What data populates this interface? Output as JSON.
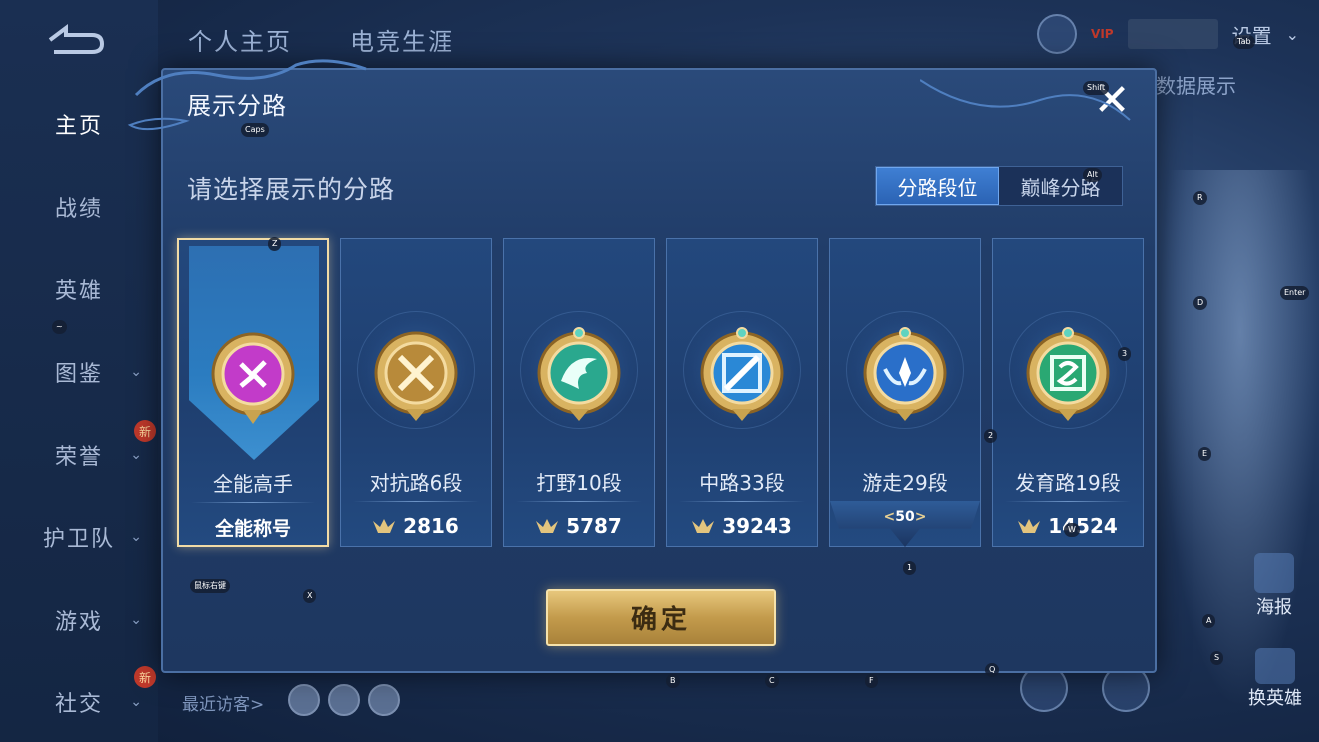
{
  "background": {
    "top_tabs": [
      "个人主页",
      "电竞生涯"
    ],
    "sidebar": [
      {
        "label": "主页",
        "active": true,
        "chevron": false,
        "badge": ""
      },
      {
        "label": "战绩",
        "active": false,
        "chevron": false,
        "badge": ""
      },
      {
        "label": "英雄",
        "active": false,
        "chevron": false,
        "badge": ""
      },
      {
        "label": "图鉴",
        "active": false,
        "chevron": true,
        "badge": ""
      },
      {
        "label": "荣誉",
        "active": false,
        "chevron": true,
        "badge": "新"
      },
      {
        "label": "护卫队",
        "active": false,
        "chevron": true,
        "badge": ""
      },
      {
        "label": "游戏",
        "active": false,
        "chevron": true,
        "badge": ""
      },
      {
        "label": "社交",
        "active": false,
        "chevron": true,
        "badge": "新"
      }
    ],
    "settings_label": "设置",
    "vip_label": "VIP",
    "right_text": "数据展示",
    "right_button_1": "海报",
    "right_button_2": "换英雄",
    "visitor_label": "最近访客>"
  },
  "key_hints": {
    "caps": "Caps",
    "shift": "Shift",
    "tab": "Tab",
    "alt": "Alt",
    "z": "Z",
    "r": "R",
    "d": "D",
    "enter": "Enter",
    "n3": "3",
    "n2": "2",
    "e": "E",
    "n1": "1",
    "w": "W",
    "mouse_right": "鼠标右键",
    "x": "X",
    "a": "A",
    "s": "S",
    "b": "B",
    "c": "C",
    "f": "F",
    "q": "Q",
    "tilde": "~"
  },
  "modal": {
    "title": "展示分路",
    "subtitle": "请选择展示的分路",
    "tabs": [
      {
        "label": "分路段位",
        "active": true
      },
      {
        "label": "巅峰分路",
        "active": false
      }
    ],
    "confirm_label": "确定",
    "cards": [
      {
        "name": "全能高手",
        "footer": "全能称号",
        "points": "",
        "selected": true,
        "medal_color": "#c23bc9",
        "icon": "all-round-medal-icon"
      },
      {
        "name": "对抗路6段",
        "footer": "",
        "points": "2816",
        "selected": false,
        "medal_color": "#b88a3a",
        "icon": "clash-lane-medal-icon"
      },
      {
        "name": "打野10段",
        "footer": "",
        "points": "5787",
        "selected": false,
        "medal_color": "#2aa88e",
        "icon": "jungle-medal-icon"
      },
      {
        "name": "中路33段",
        "footer": "",
        "points": "39243",
        "selected": false,
        "medal_color": "#2a88d6",
        "icon": "mid-lane-medal-icon"
      },
      {
        "name": "游走29段",
        "footer": "",
        "points": "",
        "peak_level": "50",
        "selected": false,
        "medal_color": "#2a6fc9",
        "icon": "roam-medal-icon"
      },
      {
        "name": "发育路19段",
        "footer": "",
        "points": "14524",
        "selected": false,
        "medal_color": "#2aa873",
        "icon": "farm-lane-medal-icon"
      }
    ]
  }
}
